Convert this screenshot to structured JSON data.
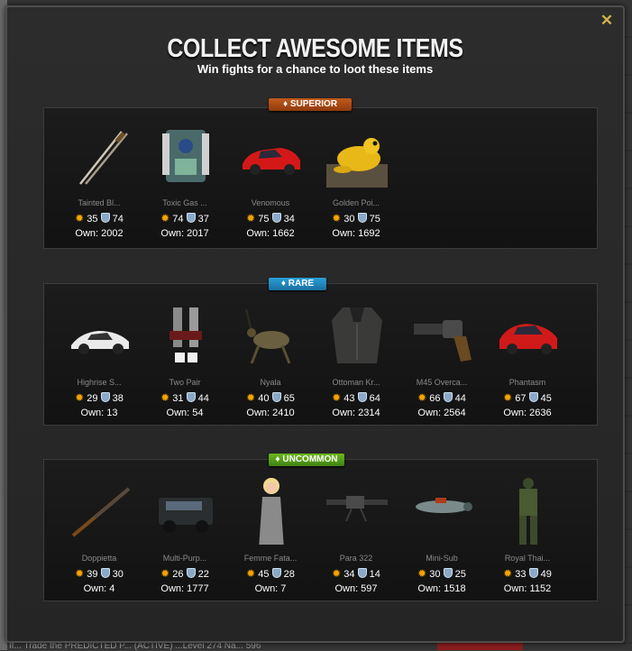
{
  "page": {
    "footer_text": "If... Trade the PREDICTED P... (ACTIVE) ...Level 274 Na... 596"
  },
  "modal": {
    "title": "COLLECT AWESOME ITEMS",
    "subtitle": "Win fights for a chance to loot these items",
    "close_icon": "close-x-icon"
  },
  "sections": [
    {
      "badge": "♦ SUPERIOR",
      "color": "#b24c16",
      "items": [
        {
          "name": "Tainted Bl...",
          "attack": "35",
          "defense": "74",
          "own": "Own: 2002",
          "icon": "twin-swords"
        },
        {
          "name": "Toxic Gas ...",
          "attack": "74",
          "defense": "37",
          "own": "Own: 2017",
          "icon": "gas-canister"
        },
        {
          "name": "Venomous",
          "attack": "75",
          "defense": "34",
          "own": "Own: 1662",
          "icon": "red-sports-car"
        },
        {
          "name": "Golden Poi...",
          "attack": "30",
          "defense": "75",
          "own": "Own: 1692",
          "icon": "golden-frog"
        }
      ]
    },
    {
      "badge": "♦ RARE",
      "color": "#2491c8",
      "items": [
        {
          "name": "Highrise S...",
          "attack": "29",
          "defense": "38",
          "own": "Own: 13",
          "icon": "white-car"
        },
        {
          "name": "Two Pair",
          "attack": "31",
          "defense": "44",
          "own": "Own: 54",
          "icon": "pistols-dice"
        },
        {
          "name": "Nyala",
          "attack": "40",
          "defense": "65",
          "own": "Own: 2410",
          "icon": "antelope"
        },
        {
          "name": "Ottoman Kr...",
          "attack": "43",
          "defense": "64",
          "own": "Own: 2314",
          "icon": "armor-vest"
        },
        {
          "name": "M45 Overca...",
          "attack": "66",
          "defense": "44",
          "own": "Own: 2564",
          "icon": "revolver"
        },
        {
          "name": "Phantasm",
          "attack": "67",
          "defense": "45",
          "own": "Own: 2636",
          "icon": "red-supercar"
        }
      ]
    },
    {
      "badge": "♦ UNCOMMON",
      "color": "#5aa418",
      "items": [
        {
          "name": "Doppietta",
          "attack": "39",
          "defense": "30",
          "own": "Own: 4",
          "icon": "shotgun"
        },
        {
          "name": "Multi-Purp...",
          "attack": "26",
          "defense": "22",
          "own": "Own: 1777",
          "icon": "armored-suv"
        },
        {
          "name": "Femme Fata...",
          "attack": "45",
          "defense": "28",
          "own": "Own: 7",
          "icon": "blonde-woman"
        },
        {
          "name": "Para 322",
          "attack": "34",
          "defense": "14",
          "own": "Own: 597",
          "icon": "machine-gun"
        },
        {
          "name": "Mini-Sub",
          "attack": "30",
          "defense": "25",
          "own": "Own: 1518",
          "icon": "mini-sub"
        },
        {
          "name": "Royal Thai...",
          "attack": "33",
          "defense": "49",
          "own": "Own: 1152",
          "icon": "soldier"
        }
      ]
    }
  ]
}
